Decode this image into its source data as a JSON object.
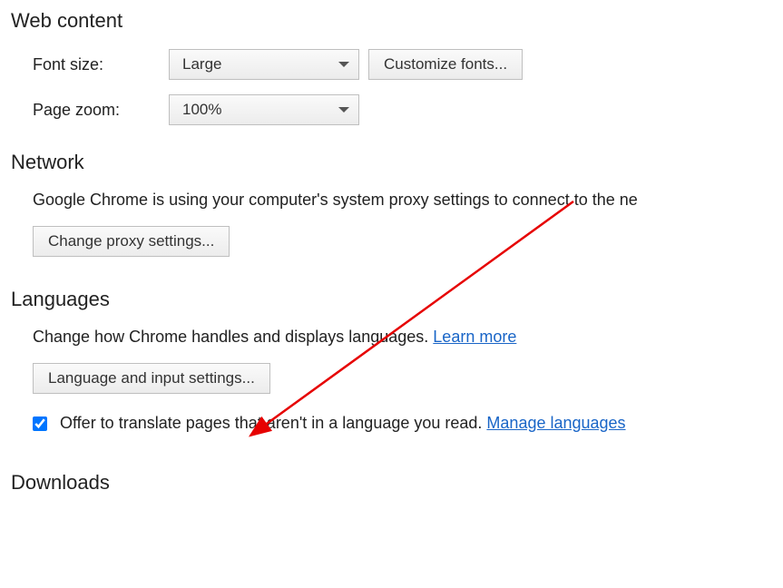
{
  "web_content": {
    "header": "Web content",
    "font_size_label": "Font size:",
    "font_size_value": "Large",
    "customize_fonts_button": "Customize fonts...",
    "page_zoom_label": "Page zoom:",
    "page_zoom_value": "100%"
  },
  "network": {
    "header": "Network",
    "body": "Google Chrome is using your computer's system proxy settings to connect to the ne",
    "change_proxy_button": "Change proxy settings..."
  },
  "languages": {
    "header": "Languages",
    "body_prefix": "Change how Chrome handles and displays languages. ",
    "learn_more": "Learn more",
    "language_settings_button": "Language and input settings...",
    "offer_translate_label": "Offer to translate pages that aren't in a language you read. ",
    "manage_languages": "Manage languages",
    "offer_translate_checked": true
  },
  "downloads": {
    "header": "Downloads"
  }
}
